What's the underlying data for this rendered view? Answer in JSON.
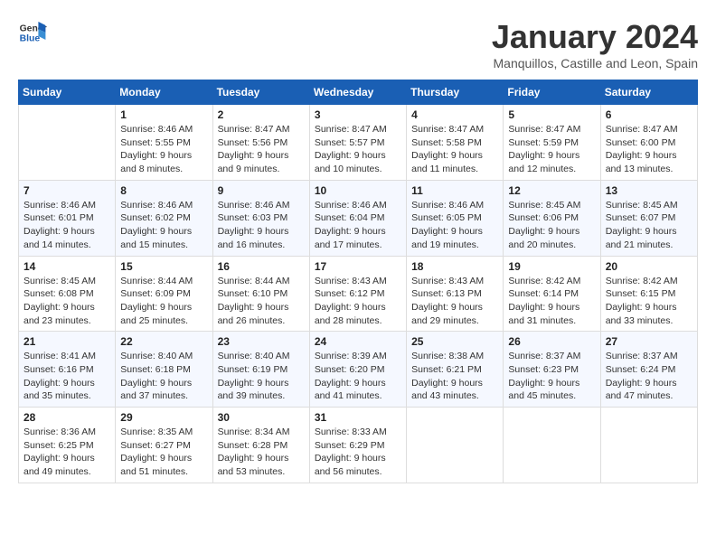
{
  "logo": {
    "line1": "General",
    "line2": "Blue"
  },
  "title": "January 2024",
  "subtitle": "Manquillos, Castille and Leon, Spain",
  "weekdays": [
    "Sunday",
    "Monday",
    "Tuesday",
    "Wednesday",
    "Thursday",
    "Friday",
    "Saturday"
  ],
  "weeks": [
    [
      {
        "day": "",
        "sunrise": "",
        "sunset": "",
        "daylight": ""
      },
      {
        "day": "1",
        "sunrise": "Sunrise: 8:46 AM",
        "sunset": "Sunset: 5:55 PM",
        "daylight": "Daylight: 9 hours and 8 minutes."
      },
      {
        "day": "2",
        "sunrise": "Sunrise: 8:47 AM",
        "sunset": "Sunset: 5:56 PM",
        "daylight": "Daylight: 9 hours and 9 minutes."
      },
      {
        "day": "3",
        "sunrise": "Sunrise: 8:47 AM",
        "sunset": "Sunset: 5:57 PM",
        "daylight": "Daylight: 9 hours and 10 minutes."
      },
      {
        "day": "4",
        "sunrise": "Sunrise: 8:47 AM",
        "sunset": "Sunset: 5:58 PM",
        "daylight": "Daylight: 9 hours and 11 minutes."
      },
      {
        "day": "5",
        "sunrise": "Sunrise: 8:47 AM",
        "sunset": "Sunset: 5:59 PM",
        "daylight": "Daylight: 9 hours and 12 minutes."
      },
      {
        "day": "6",
        "sunrise": "Sunrise: 8:47 AM",
        "sunset": "Sunset: 6:00 PM",
        "daylight": "Daylight: 9 hours and 13 minutes."
      }
    ],
    [
      {
        "day": "7",
        "sunrise": "Sunrise: 8:46 AM",
        "sunset": "Sunset: 6:01 PM",
        "daylight": "Daylight: 9 hours and 14 minutes."
      },
      {
        "day": "8",
        "sunrise": "Sunrise: 8:46 AM",
        "sunset": "Sunset: 6:02 PM",
        "daylight": "Daylight: 9 hours and 15 minutes."
      },
      {
        "day": "9",
        "sunrise": "Sunrise: 8:46 AM",
        "sunset": "Sunset: 6:03 PM",
        "daylight": "Daylight: 9 hours and 16 minutes."
      },
      {
        "day": "10",
        "sunrise": "Sunrise: 8:46 AM",
        "sunset": "Sunset: 6:04 PM",
        "daylight": "Daylight: 9 hours and 17 minutes."
      },
      {
        "day": "11",
        "sunrise": "Sunrise: 8:46 AM",
        "sunset": "Sunset: 6:05 PM",
        "daylight": "Daylight: 9 hours and 19 minutes."
      },
      {
        "day": "12",
        "sunrise": "Sunrise: 8:45 AM",
        "sunset": "Sunset: 6:06 PM",
        "daylight": "Daylight: 9 hours and 20 minutes."
      },
      {
        "day": "13",
        "sunrise": "Sunrise: 8:45 AM",
        "sunset": "Sunset: 6:07 PM",
        "daylight": "Daylight: 9 hours and 21 minutes."
      }
    ],
    [
      {
        "day": "14",
        "sunrise": "Sunrise: 8:45 AM",
        "sunset": "Sunset: 6:08 PM",
        "daylight": "Daylight: 9 hours and 23 minutes."
      },
      {
        "day": "15",
        "sunrise": "Sunrise: 8:44 AM",
        "sunset": "Sunset: 6:09 PM",
        "daylight": "Daylight: 9 hours and 25 minutes."
      },
      {
        "day": "16",
        "sunrise": "Sunrise: 8:44 AM",
        "sunset": "Sunset: 6:10 PM",
        "daylight": "Daylight: 9 hours and 26 minutes."
      },
      {
        "day": "17",
        "sunrise": "Sunrise: 8:43 AM",
        "sunset": "Sunset: 6:12 PM",
        "daylight": "Daylight: 9 hours and 28 minutes."
      },
      {
        "day": "18",
        "sunrise": "Sunrise: 8:43 AM",
        "sunset": "Sunset: 6:13 PM",
        "daylight": "Daylight: 9 hours and 29 minutes."
      },
      {
        "day": "19",
        "sunrise": "Sunrise: 8:42 AM",
        "sunset": "Sunset: 6:14 PM",
        "daylight": "Daylight: 9 hours and 31 minutes."
      },
      {
        "day": "20",
        "sunrise": "Sunrise: 8:42 AM",
        "sunset": "Sunset: 6:15 PM",
        "daylight": "Daylight: 9 hours and 33 minutes."
      }
    ],
    [
      {
        "day": "21",
        "sunrise": "Sunrise: 8:41 AM",
        "sunset": "Sunset: 6:16 PM",
        "daylight": "Daylight: 9 hours and 35 minutes."
      },
      {
        "day": "22",
        "sunrise": "Sunrise: 8:40 AM",
        "sunset": "Sunset: 6:18 PM",
        "daylight": "Daylight: 9 hours and 37 minutes."
      },
      {
        "day": "23",
        "sunrise": "Sunrise: 8:40 AM",
        "sunset": "Sunset: 6:19 PM",
        "daylight": "Daylight: 9 hours and 39 minutes."
      },
      {
        "day": "24",
        "sunrise": "Sunrise: 8:39 AM",
        "sunset": "Sunset: 6:20 PM",
        "daylight": "Daylight: 9 hours and 41 minutes."
      },
      {
        "day": "25",
        "sunrise": "Sunrise: 8:38 AM",
        "sunset": "Sunset: 6:21 PM",
        "daylight": "Daylight: 9 hours and 43 minutes."
      },
      {
        "day": "26",
        "sunrise": "Sunrise: 8:37 AM",
        "sunset": "Sunset: 6:23 PM",
        "daylight": "Daylight: 9 hours and 45 minutes."
      },
      {
        "day": "27",
        "sunrise": "Sunrise: 8:37 AM",
        "sunset": "Sunset: 6:24 PM",
        "daylight": "Daylight: 9 hours and 47 minutes."
      }
    ],
    [
      {
        "day": "28",
        "sunrise": "Sunrise: 8:36 AM",
        "sunset": "Sunset: 6:25 PM",
        "daylight": "Daylight: 9 hours and 49 minutes."
      },
      {
        "day": "29",
        "sunrise": "Sunrise: 8:35 AM",
        "sunset": "Sunset: 6:27 PM",
        "daylight": "Daylight: 9 hours and 51 minutes."
      },
      {
        "day": "30",
        "sunrise": "Sunrise: 8:34 AM",
        "sunset": "Sunset: 6:28 PM",
        "daylight": "Daylight: 9 hours and 53 minutes."
      },
      {
        "day": "31",
        "sunrise": "Sunrise: 8:33 AM",
        "sunset": "Sunset: 6:29 PM",
        "daylight": "Daylight: 9 hours and 56 minutes."
      },
      {
        "day": "",
        "sunrise": "",
        "sunset": "",
        "daylight": ""
      },
      {
        "day": "",
        "sunrise": "",
        "sunset": "",
        "daylight": ""
      },
      {
        "day": "",
        "sunrise": "",
        "sunset": "",
        "daylight": ""
      }
    ]
  ]
}
